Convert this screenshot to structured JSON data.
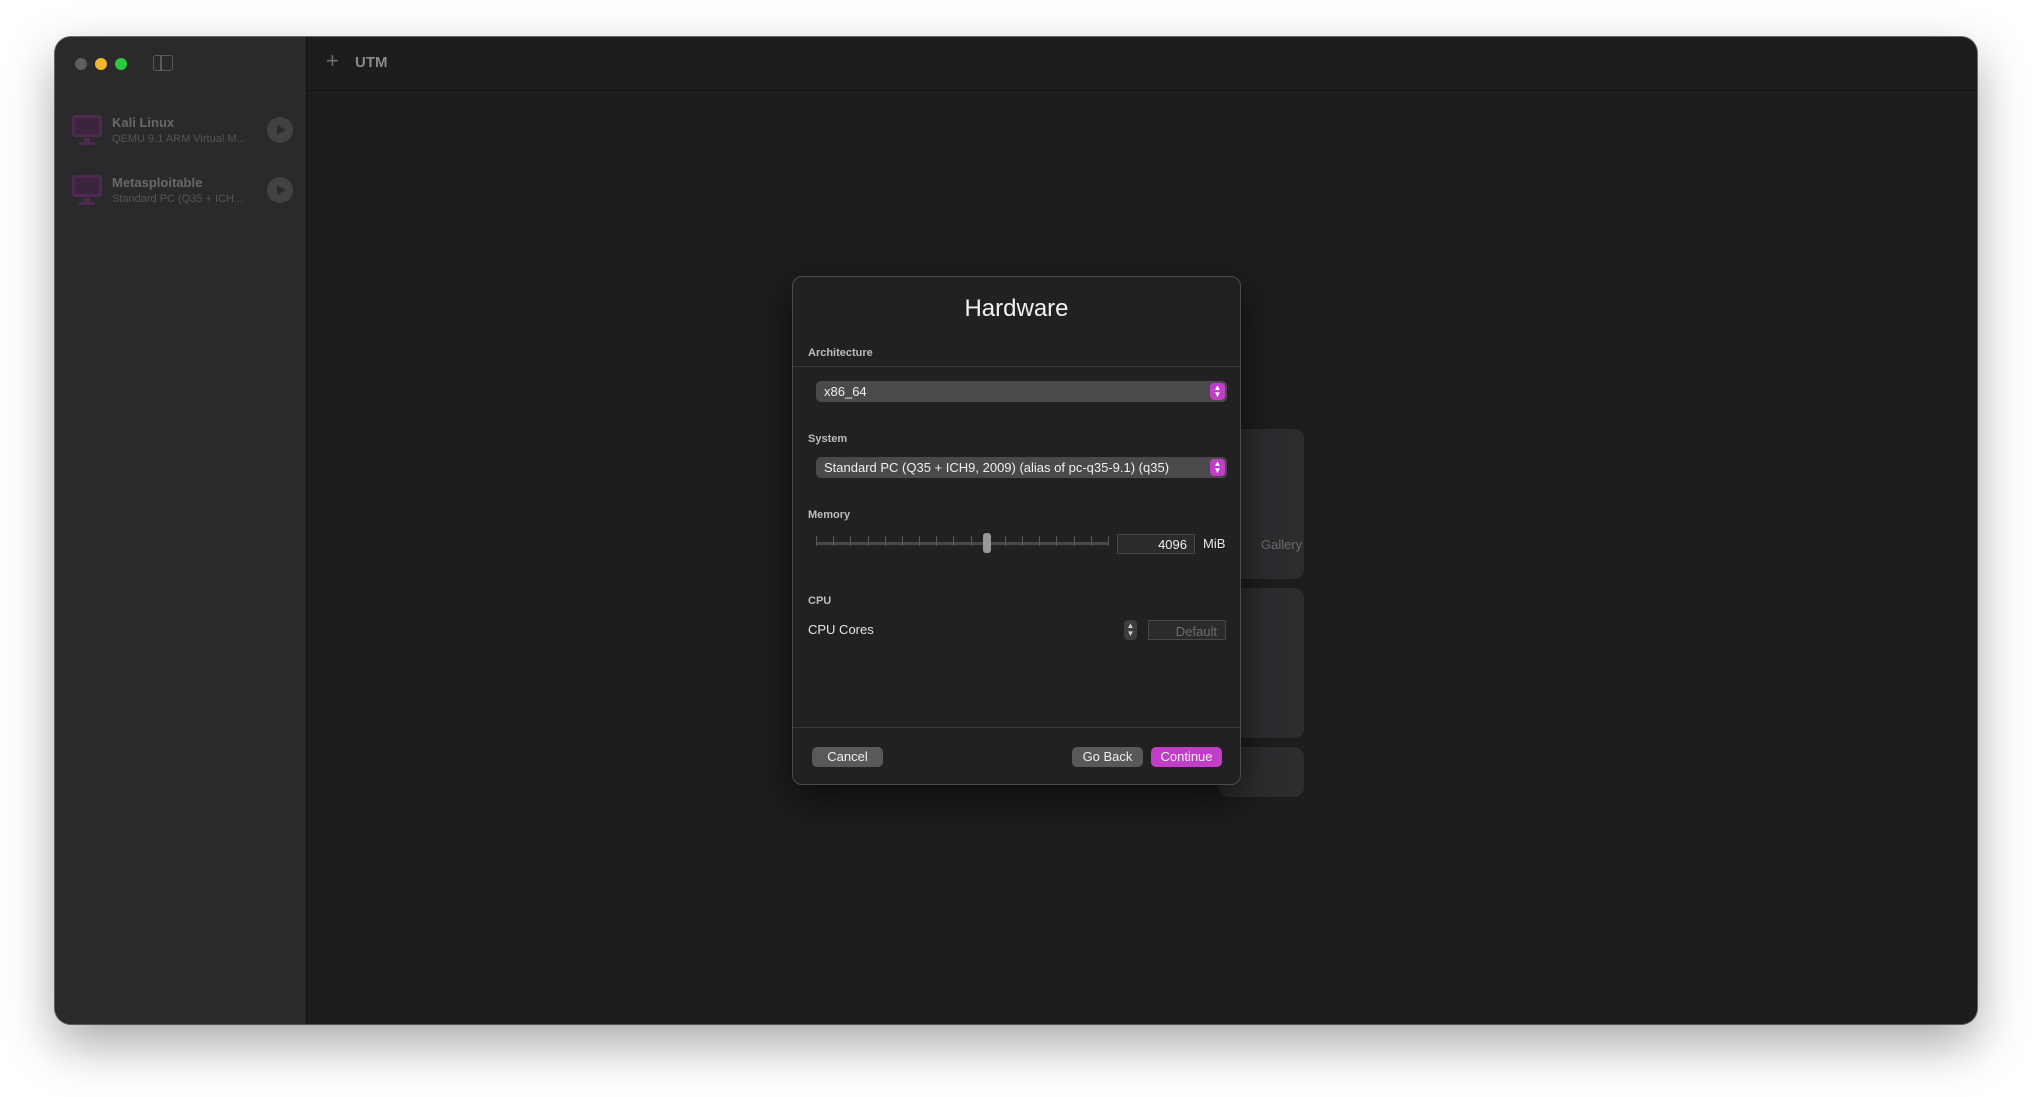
{
  "app": {
    "title": "UTM"
  },
  "sidebar": {
    "vms": [
      {
        "name": "Kali Linux",
        "subtitle": "QEMU 9.1 ARM Virtual M..."
      },
      {
        "name": "Metasploitable",
        "subtitle": "Standard PC (Q35 + ICH..."
      }
    ]
  },
  "background": {
    "gallery_text": "Gallery"
  },
  "dialog": {
    "title": "Hardware",
    "architecture": {
      "label": "Architecture",
      "value": "x86_64"
    },
    "system": {
      "label": "System",
      "value": "Standard PC (Q35 + ICH9, 2009) (alias of pc-q35-9.1) (q35)"
    },
    "memory": {
      "label": "Memory",
      "value": "4096",
      "unit": "MiB"
    },
    "cpu": {
      "label": "CPU",
      "cores_label": "CPU Cores",
      "cores_placeholder": "Default"
    },
    "buttons": {
      "cancel": "Cancel",
      "go_back": "Go Back",
      "continue": "Continue"
    }
  },
  "colors": {
    "accent": "#c13ec6",
    "window_bg": "#1e1c1f",
    "sidebar_bg": "#2a292b"
  }
}
